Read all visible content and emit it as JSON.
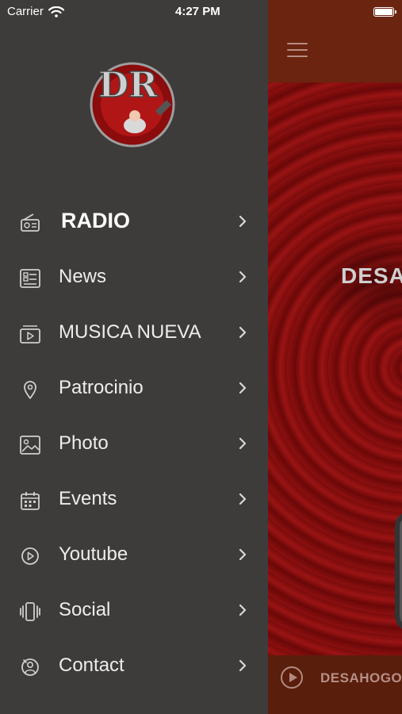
{
  "status_bar": {
    "carrier": "Carrier",
    "time": "4:27 PM"
  },
  "drawer": {
    "logo_text": "DR",
    "menu": [
      {
        "label": "RADIO",
        "icon": "radio-icon",
        "active": true
      },
      {
        "label": "News",
        "icon": "news-icon"
      },
      {
        "label": "MUSICA NUEVA",
        "icon": "video-folder-icon"
      },
      {
        "label": "Patrocinio",
        "icon": "location-pin-icon"
      },
      {
        "label": "Photo",
        "icon": "photo-icon"
      },
      {
        "label": "Events",
        "icon": "calendar-icon"
      },
      {
        "label": "Youtube",
        "icon": "play-circle-icon"
      },
      {
        "label": "Social",
        "icon": "social-icon"
      },
      {
        "label": "Contact",
        "icon": "contact-icon"
      }
    ]
  },
  "main": {
    "hero_text": "DESA",
    "player_title": "DESAHOGOU"
  },
  "colors": {
    "drawer_bg": "#3e3c3a",
    "header_bg": "#6b2410",
    "hero_red": "#8c1010",
    "text": "#ededed"
  }
}
